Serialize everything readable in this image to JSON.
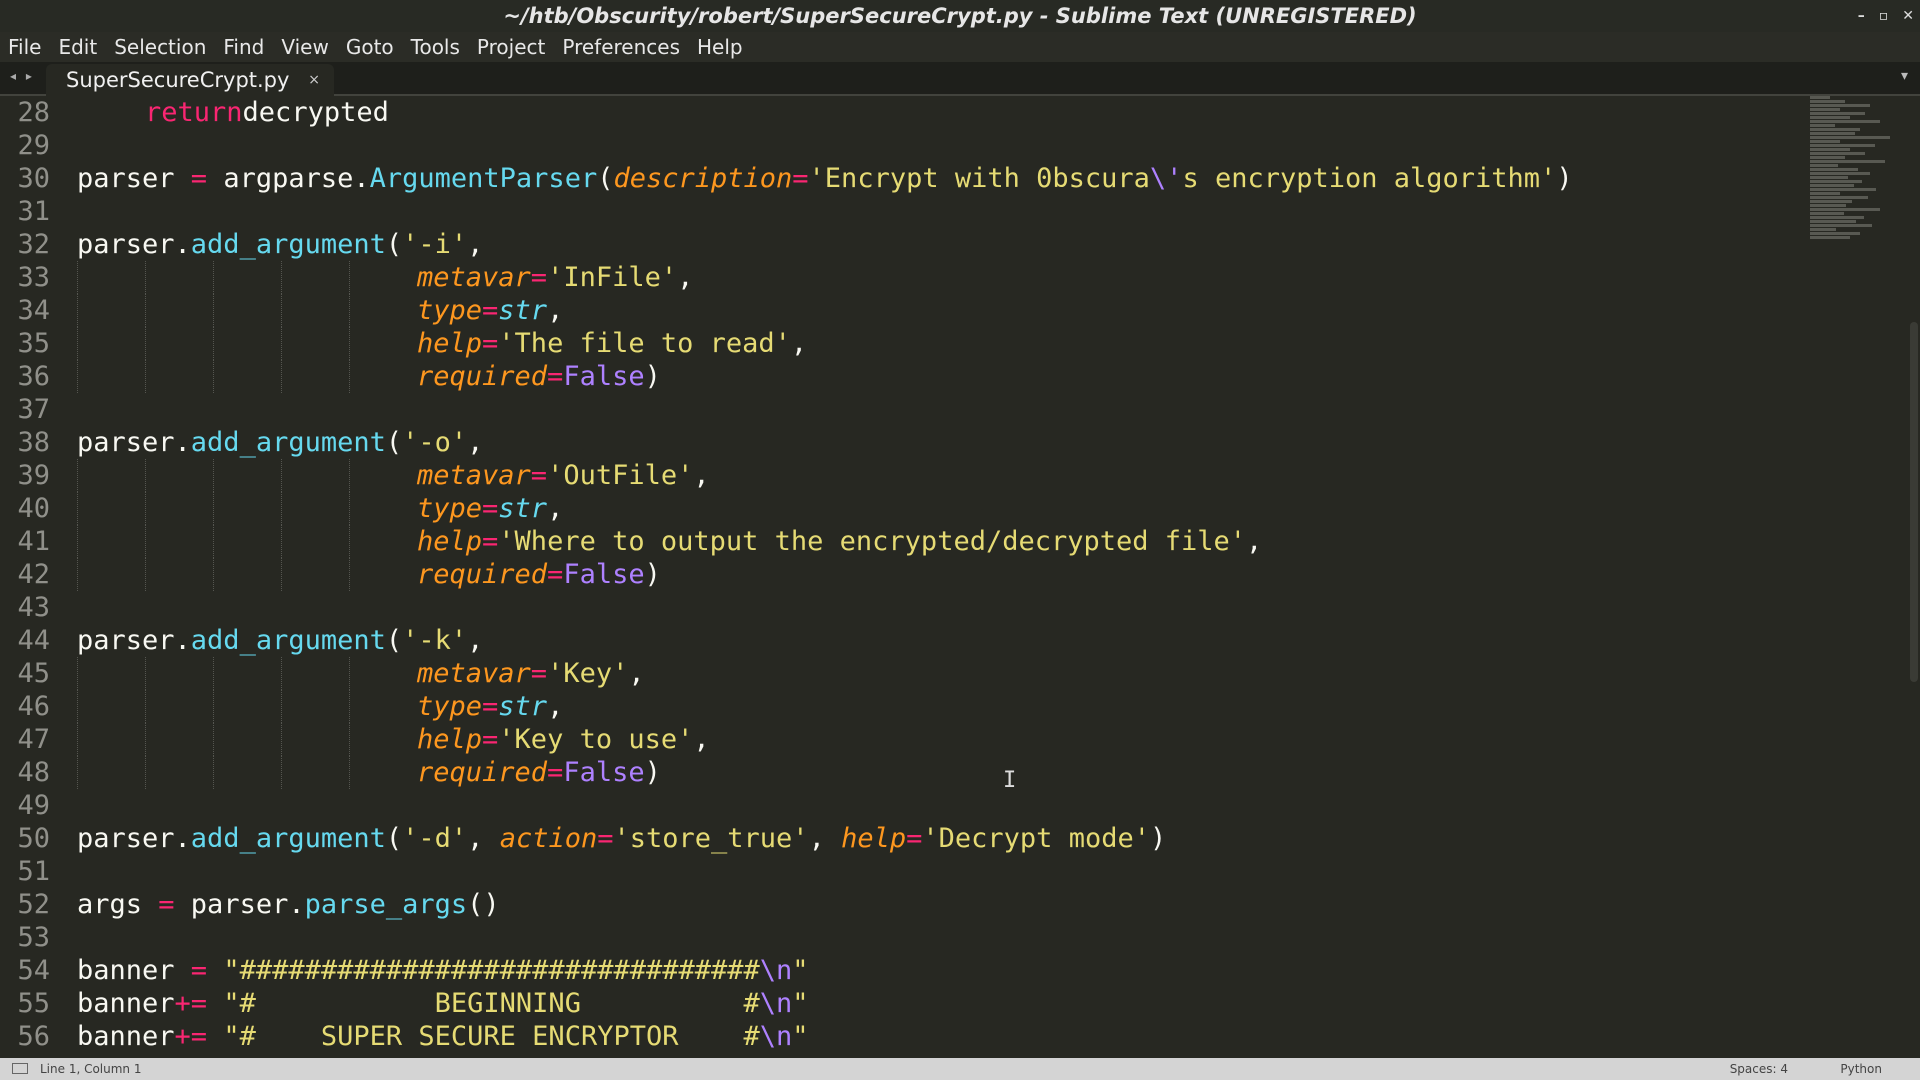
{
  "window": {
    "title": "~/htb/Obscurity/robert/SuperSecureCrypt.py - Sublime Text (UNREGISTERED)",
    "controls": [
      "–",
      "▫",
      "✕"
    ]
  },
  "menu": [
    "File",
    "Edit",
    "Selection",
    "Find",
    "View",
    "Goto",
    "Tools",
    "Project",
    "Preferences",
    "Help"
  ],
  "tabs": {
    "arrows": "◂ ▸",
    "active": "SuperSecureCrypt.py",
    "close": "×",
    "dropdown": "▾"
  },
  "editor": {
    "line_numbers": [
      "28",
      "29",
      "30",
      "31",
      "32",
      "33",
      "34",
      "35",
      "36",
      "37",
      "38",
      "39",
      "40",
      "41",
      "42",
      "43",
      "44",
      "45",
      "46",
      "47",
      "48",
      "49",
      "50",
      "51",
      "52",
      "53",
      "54",
      "55",
      "56"
    ],
    "lines": [
      {
        "indent": 1,
        "tokens": [
          [
            "kw",
            "return"
          ],
          [
            "",
            "decrypted"
          ]
        ]
      },
      {
        "indent": 0,
        "tokens": []
      },
      {
        "indent": 0,
        "tokens": [
          [
            "",
            "parser "
          ],
          [
            "op",
            "="
          ],
          [
            "",
            " argparse."
          ],
          [
            "fn",
            "ArgumentParser"
          ],
          [
            "",
            "("
          ],
          [
            "pa",
            "description"
          ],
          [
            "op",
            "="
          ],
          [
            "st",
            "'Encrypt with 0bscura"
          ],
          [
            "co",
            "\\'"
          ],
          [
            "st",
            "s encryption algorithm'"
          ],
          [
            "",
            ")"
          ]
        ]
      },
      {
        "indent": 0,
        "tokens": []
      },
      {
        "indent": 0,
        "tokens": [
          [
            "",
            "parser."
          ],
          [
            "fn",
            "add_argument"
          ],
          [
            "",
            "("
          ],
          [
            "st",
            "'-i'"
          ],
          [
            "",
            ","
          ]
        ]
      },
      {
        "indent": 5,
        "tokens": [
          [
            "pa",
            "metavar"
          ],
          [
            "op",
            "="
          ],
          [
            "st",
            "'InFile'"
          ],
          [
            "",
            ","
          ]
        ]
      },
      {
        "indent": 5,
        "tokens": [
          [
            "pa",
            "type"
          ],
          [
            "op",
            "="
          ],
          [
            "bi",
            "str"
          ],
          [
            "",
            ","
          ]
        ]
      },
      {
        "indent": 5,
        "tokens": [
          [
            "pa",
            "help"
          ],
          [
            "op",
            "="
          ],
          [
            "st",
            "'The file to read'"
          ],
          [
            "",
            ","
          ]
        ]
      },
      {
        "indent": 5,
        "tokens": [
          [
            "pa",
            "required"
          ],
          [
            "op",
            "="
          ],
          [
            "co",
            "False"
          ],
          [
            "",
            ")"
          ]
        ]
      },
      {
        "indent": 0,
        "tokens": []
      },
      {
        "indent": 0,
        "tokens": [
          [
            "",
            "parser."
          ],
          [
            "fn",
            "add_argument"
          ],
          [
            "",
            "("
          ],
          [
            "st",
            "'-o'"
          ],
          [
            "",
            ","
          ]
        ]
      },
      {
        "indent": 5,
        "tokens": [
          [
            "pa",
            "metavar"
          ],
          [
            "op",
            "="
          ],
          [
            "st",
            "'OutFile'"
          ],
          [
            "",
            ","
          ]
        ]
      },
      {
        "indent": 5,
        "tokens": [
          [
            "pa",
            "type"
          ],
          [
            "op",
            "="
          ],
          [
            "bi",
            "str"
          ],
          [
            "",
            ","
          ]
        ]
      },
      {
        "indent": 5,
        "tokens": [
          [
            "pa",
            "help"
          ],
          [
            "op",
            "="
          ],
          [
            "st",
            "'Where to output the encrypted/decrypted file'"
          ],
          [
            "",
            ","
          ]
        ]
      },
      {
        "indent": 5,
        "tokens": [
          [
            "pa",
            "required"
          ],
          [
            "op",
            "="
          ],
          [
            "co",
            "False"
          ],
          [
            "",
            ")"
          ]
        ]
      },
      {
        "indent": 0,
        "tokens": []
      },
      {
        "indent": 0,
        "tokens": [
          [
            "",
            "parser."
          ],
          [
            "fn",
            "add_argument"
          ],
          [
            "",
            "("
          ],
          [
            "st",
            "'-k'"
          ],
          [
            "",
            ","
          ]
        ]
      },
      {
        "indent": 5,
        "tokens": [
          [
            "pa",
            "metavar"
          ],
          [
            "op",
            "="
          ],
          [
            "st",
            "'Key'"
          ],
          [
            "",
            ","
          ]
        ]
      },
      {
        "indent": 5,
        "tokens": [
          [
            "pa",
            "type"
          ],
          [
            "op",
            "="
          ],
          [
            "bi",
            "str"
          ],
          [
            "",
            ","
          ]
        ]
      },
      {
        "indent": 5,
        "tokens": [
          [
            "pa",
            "help"
          ],
          [
            "op",
            "="
          ],
          [
            "st",
            "'Key to use'"
          ],
          [
            "",
            ","
          ]
        ]
      },
      {
        "indent": 5,
        "tokens": [
          [
            "pa",
            "required"
          ],
          [
            "op",
            "="
          ],
          [
            "co",
            "False"
          ],
          [
            "",
            ")"
          ]
        ]
      },
      {
        "indent": 0,
        "tokens": []
      },
      {
        "indent": 0,
        "tokens": [
          [
            "",
            "parser."
          ],
          [
            "fn",
            "add_argument"
          ],
          [
            "",
            "("
          ],
          [
            "st",
            "'-d'"
          ],
          [
            "",
            ", "
          ],
          [
            "pa",
            "action"
          ],
          [
            "op",
            "="
          ],
          [
            "st",
            "'store_true'"
          ],
          [
            "",
            ", "
          ],
          [
            "pa",
            "help"
          ],
          [
            "op",
            "="
          ],
          [
            "st",
            "'Decrypt mode'"
          ],
          [
            "",
            ")"
          ]
        ]
      },
      {
        "indent": 0,
        "tokens": []
      },
      {
        "indent": 0,
        "tokens": [
          [
            "",
            "args "
          ],
          [
            "op",
            "="
          ],
          [
            "",
            " parser."
          ],
          [
            "fn",
            "parse_args"
          ],
          [
            "",
            "()"
          ]
        ]
      },
      {
        "indent": 0,
        "tokens": []
      },
      {
        "indent": 0,
        "tokens": [
          [
            "",
            "banner "
          ],
          [
            "op",
            "="
          ],
          [
            "",
            " "
          ],
          [
            "st",
            "\"################################"
          ],
          [
            "co",
            "\\n"
          ],
          [
            "st",
            "\""
          ]
        ]
      },
      {
        "indent": 0,
        "tokens": [
          [
            "",
            "banner"
          ],
          [
            "op",
            "+="
          ],
          [
            "",
            " "
          ],
          [
            "st",
            "\"#           BEGINNING          #"
          ],
          [
            "co",
            "\\n"
          ],
          [
            "st",
            "\""
          ]
        ]
      },
      {
        "indent": 0,
        "tokens": [
          [
            "",
            "banner"
          ],
          [
            "op",
            "+="
          ],
          [
            "",
            " "
          ],
          [
            "st",
            "\"#    SUPER SECURE ENCRYPTOR    #"
          ],
          [
            "co",
            "\\n"
          ],
          [
            "st",
            "\""
          ]
        ]
      }
    ]
  },
  "status": {
    "position": "Line 1, Column 1",
    "spaces": "Spaces: 4",
    "syntax": "Python"
  },
  "colors": {
    "background": "#272822",
    "keyword": "#f92672",
    "function": "#66d9ef",
    "string": "#e6db74",
    "parameter": "#fd971f",
    "constant": "#ae81ff"
  }
}
